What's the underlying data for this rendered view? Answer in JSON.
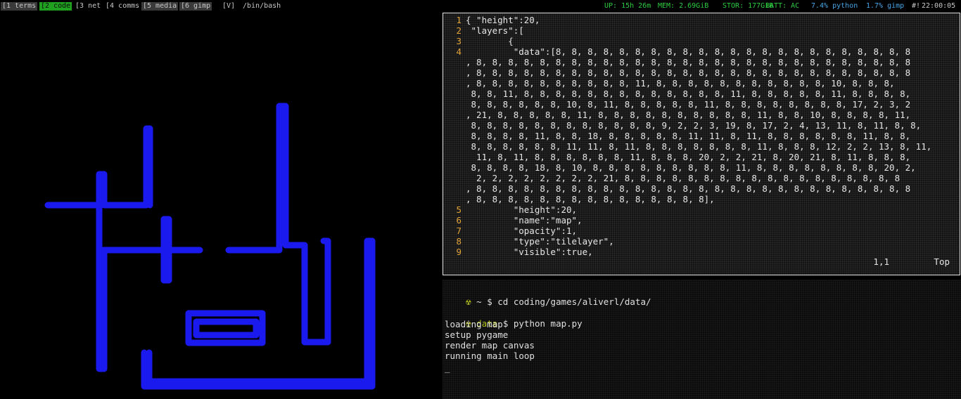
{
  "statusbar": {
    "workspaces": [
      {
        "label": "[1 terms",
        "active": false
      },
      {
        "label": "[2 code",
        "active": true
      },
      {
        "label": "[3 net",
        "active": false
      },
      {
        "label": "[4 comms",
        "active": false
      },
      {
        "label": "[5 media",
        "active": false
      },
      {
        "label": "[6 gimp",
        "active": false
      }
    ],
    "layout": "[V]",
    "window_title": "/bin/bash",
    "uptime": "UP: 15h 26m",
    "memory": "MEM: 2.69GiB",
    "storage": "STOR: 177GiB",
    "battery": "BATT: AC",
    "proc1": "7.4% python",
    "proc2": "1.7% gimp",
    "hash": "#!",
    "clock": "22:00:05"
  },
  "editor": {
    "lines": [
      {
        "no": "1",
        "text": "{ \"height\":20,"
      },
      {
        "no": "2",
        "text": " \"layers\":["
      },
      {
        "no": "3",
        "text": "        {"
      },
      {
        "no": "4",
        "text": "         \"data\":[8, 8, 8, 8, 8, 8, 8, 8, 8, 8, 8, 8, 8, 8, 8, 8, 8, 8, 8, 8, 8, 8, 8"
      },
      {
        "no": "",
        "text": ", 8, 8, 8, 8, 8, 8, 8, 8, 8, 8, 8, 8, 8, 8, 8, 8, 8, 8, 8, 8, 8, 8, 8, 8, 8, 8, 8, 8"
      },
      {
        "no": "",
        "text": ", 8, 8, 8, 8, 8, 8, 8, 8, 8, 8, 8, 8, 8, 8, 8, 8, 8, 8, 8, 8, 8, 8, 8, 8, 8, 8, 8, 8"
      },
      {
        "no": "",
        "text": ", 8, 8, 8, 8, 8, 8, 8, 8, 8, 8, 11, 8, 8, 8, 8, 8, 8, 8, 8, 8, 8, 8, 10, 8, 8, 8,"
      },
      {
        "no": "",
        "text": " 8, 8, 11, 8, 8, 8, 8, 8, 8, 8, 8, 8, 8, 8, 8, 8, 11, 8, 8, 8, 8, 8, 11, 8, 8, 8, 8,"
      },
      {
        "no": "",
        "text": " 8, 8, 8, 8, 8, 8, 10, 8, 11, 8, 8, 8, 8, 8, 11, 8, 8, 8, 8, 8, 8, 8, 8, 17, 2, 3, 2"
      },
      {
        "no": "",
        "text": ", 21, 8, 8, 8, 8, 8, 11, 8, 8, 8, 8, 8, 8, 8, 8, 8, 8, 11, 8, 8, 10, 8, 8, 8, 8, 11,"
      },
      {
        "no": "",
        "text": " 8, 8, 8, 8, 8, 8, 8, 8, 8, 8, 8, 8, 9, 2, 2, 3, 19, 8, 17, 2, 4, 13, 11, 8, 11, 8, 8,"
      },
      {
        "no": "",
        "text": " 8, 8, 8, 8, 11, 8, 8, 18, 8, 8, 8, 8, 8, 11, 11, 8, 11, 8, 8, 8, 8, 8, 8, 11, 8, 8,"
      },
      {
        "no": "",
        "text": " 8, 8, 8, 8, 8, 8, 11, 11, 8, 11, 8, 8, 8, 8, 8, 8, 8, 11, 8, 8, 8, 12, 2, 2, 13, 8, 11,"
      },
      {
        "no": "",
        "text": "  11, 8, 11, 8, 8, 8, 8, 8, 8, 11, 8, 8, 8, 20, 2, 2, 21, 8, 20, 21, 8, 11, 8, 8, 8,"
      },
      {
        "no": "",
        "text": " 8, 8, 8, 8, 18, 8, 10, 8, 8, 8, 8, 8, 8, 8, 8, 8, 11, 8, 8, 8, 8, 8, 8, 8, 8, 20, 2,"
      },
      {
        "no": "",
        "text": "  2, 2, 2, 2, 2, 2, 2, 2, 21, 8, 8, 8, 8, 8, 8, 8, 8, 8, 8, 8, 8, 8, 8, 8, 8, 8, 8"
      },
      {
        "no": "",
        "text": ", 8, 8, 8, 8, 8, 8, 8, 8, 8, 8, 8, 8, 8, 8, 8, 8, 8, 8, 8, 8, 8, 8, 8, 8, 8, 8, 8, 8"
      },
      {
        "no": "",
        "text": ", 8, 8, 8, 8, 8, 8, 8, 8, 8, 8, 8, 8, 8, 8, 8],"
      },
      {
        "no": "5",
        "text": "         \"height\":20,"
      },
      {
        "no": "6",
        "text": "         \"name\":\"map\","
      },
      {
        "no": "7",
        "text": "         \"opacity\":1,"
      },
      {
        "no": "8",
        "text": "         \"type\":\"tilelayer\","
      },
      {
        "no": "9",
        "text": "         \"visible\":true,"
      }
    ],
    "cursor_pos": "1,1",
    "scroll": "Top"
  },
  "terminal": {
    "symbol": "☢",
    "prompt1_dir": "~",
    "prompt1_cmd": "$ cd coding/games/aliverl/data/",
    "prompt2_dir": "data",
    "prompt2_cmd": "$ python map.py",
    "out1": "loading map",
    "out2": "setup pygame",
    "out3": "render map canvas",
    "out4": "running main loop",
    "cursor": "_"
  },
  "colors": {
    "wall": "#1a1aee",
    "active_tag": "#1fa01f",
    "line_number": "#e3a53a",
    "prompt_symbol": "#b5c11f"
  }
}
